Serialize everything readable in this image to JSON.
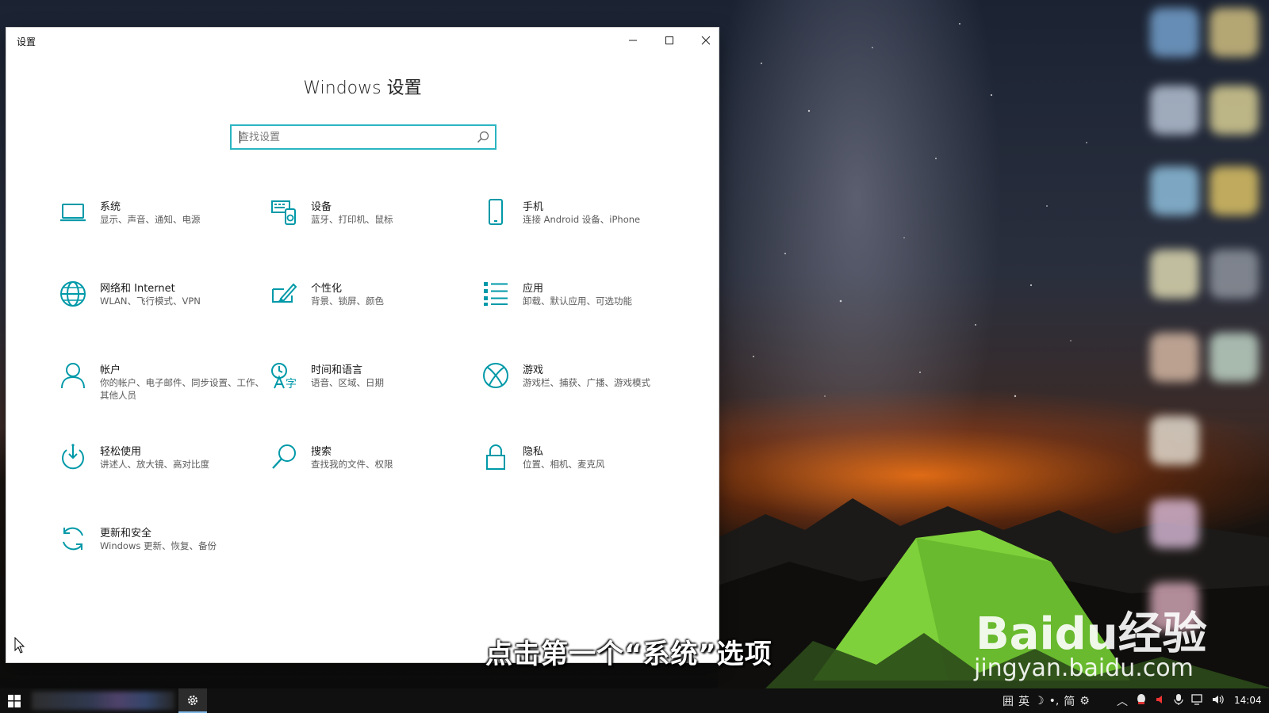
{
  "window": {
    "title": "设置",
    "heading": "Windows 设置",
    "search_placeholder": "查找设置"
  },
  "tiles": [
    {
      "title": "系统",
      "desc": "显示、声音、通知、电源",
      "icon": "laptop-icon"
    },
    {
      "title": "设备",
      "desc": "蓝牙、打印机、鼠标",
      "icon": "devices-icon"
    },
    {
      "title": "手机",
      "desc": "连接 Android 设备、iPhone",
      "icon": "phone-icon"
    },
    {
      "title": "网络和 Internet",
      "desc": "WLAN、飞行模式、VPN",
      "icon": "globe-icon"
    },
    {
      "title": "个性化",
      "desc": "背景、锁屏、颜色",
      "icon": "paint-icon"
    },
    {
      "title": "应用",
      "desc": "卸载、默认应用、可选功能",
      "icon": "apps-list-icon"
    },
    {
      "title": "帐户",
      "desc": "你的帐户、电子邮件、同步设置、工作、其他人员",
      "icon": "person-icon"
    },
    {
      "title": "时间和语言",
      "desc": "语音、区域、日期",
      "icon": "time-language-icon"
    },
    {
      "title": "游戏",
      "desc": "游戏栏、捕获、广播、游戏模式",
      "icon": "xbox-icon"
    },
    {
      "title": "轻松使用",
      "desc": "讲述人、放大镜、高对比度",
      "icon": "ease-of-access-icon"
    },
    {
      "title": "搜索",
      "desc": "查找我的文件、权限",
      "icon": "search-icon"
    },
    {
      "title": "隐私",
      "desc": "位置、相机、麦克风",
      "icon": "lock-icon"
    },
    {
      "title": "更新和安全",
      "desc": "Windows 更新、恢复、备份",
      "icon": "update-icon"
    }
  ],
  "caption": "点击第一个“系统”选项",
  "watermark": {
    "logo": "Baidu经验",
    "url": "jingyan.baidu.com"
  },
  "taskbar": {
    "ime": [
      "囲",
      "英",
      "☽",
      "•,",
      "简",
      "⚙"
    ],
    "clock": "14:04"
  },
  "colors": {
    "accent": "#0099a8",
    "search_border": "#2bb5c2"
  }
}
